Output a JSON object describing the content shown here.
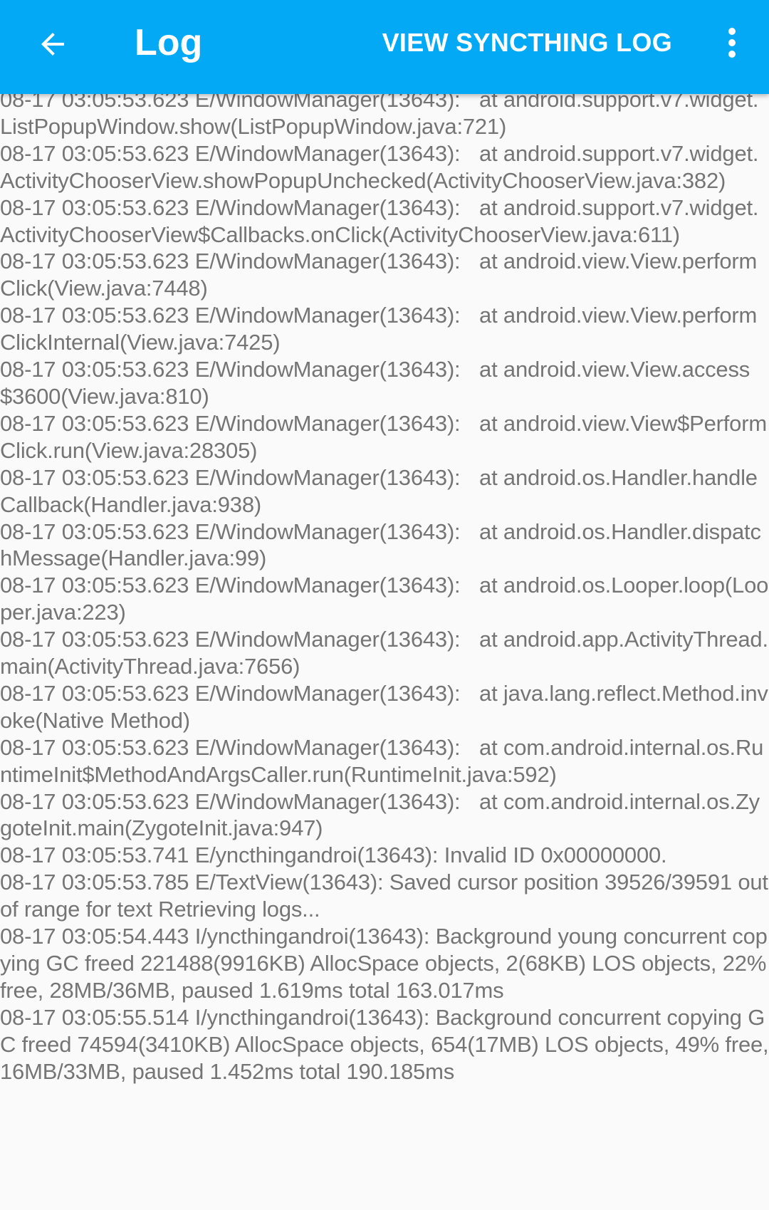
{
  "toolbar": {
    "title": "Log",
    "action_label": "VIEW SYNCTHING LOG",
    "back_icon": "arrow-back-icon",
    "overflow_icon": "more-vert-icon",
    "background_color": "#03a9f4"
  },
  "log": {
    "text": "08-17 03:05:53.623 E/WindowManager(13643): \tat android.support.v7.widget.ListPopupWindow.show(ListPopupWindow.java:721)\n08-17 03:05:53.623 E/WindowManager(13643): \tat android.support.v7.widget.ActivityChooserView.showPopupUnchecked(ActivityChooserView.java:382)\n08-17 03:05:53.623 E/WindowManager(13643): \tat android.support.v7.widget.ActivityChooserView$Callbacks.onClick(ActivityChooserView.java:611)\n08-17 03:05:53.623 E/WindowManager(13643): \tat android.view.View.performClick(View.java:7448)\n08-17 03:05:53.623 E/WindowManager(13643): \tat android.view.View.performClickInternal(View.java:7425)\n08-17 03:05:53.623 E/WindowManager(13643): \tat android.view.View.access$3600(View.java:810)\n08-17 03:05:53.623 E/WindowManager(13643): \tat android.view.View$PerformClick.run(View.java:28305)\n08-17 03:05:53.623 E/WindowManager(13643): \tat android.os.Handler.handleCallback(Handler.java:938)\n08-17 03:05:53.623 E/WindowManager(13643): \tat android.os.Handler.dispatchMessage(Handler.java:99)\n08-17 03:05:53.623 E/WindowManager(13643): \tat android.os.Looper.loop(Looper.java:223)\n08-17 03:05:53.623 E/WindowManager(13643): \tat android.app.ActivityThread.main(ActivityThread.java:7656)\n08-17 03:05:53.623 E/WindowManager(13643): \tat java.lang.reflect.Method.invoke(Native Method)\n08-17 03:05:53.623 E/WindowManager(13643): \tat com.android.internal.os.RuntimeInit$MethodAndArgsCaller.run(RuntimeInit.java:592)\n08-17 03:05:53.623 E/WindowManager(13643): \tat com.android.internal.os.ZygoteInit.main(ZygoteInit.java:947)\n08-17 03:05:53.741 E/yncthingandroi(13643): Invalid ID 0x00000000.\n08-17 03:05:53.785 E/TextView(13643): Saved cursor position 39526/39591 out of range for text Retrieving logs...\n08-17 03:05:54.443 I/yncthingandroi(13643): Background young concurrent copying GC freed 221488(9916KB) AllocSpace objects, 2(68KB) LOS objects, 22% free, 28MB/36MB, paused 1.619ms total 163.017ms\n08-17 03:05:55.514 I/yncthingandroi(13643): Background concurrent copying GC freed 74594(3410KB) AllocSpace objects, 654(17MB) LOS objects, 49% free, 16MB/33MB, paused 1.452ms total 190.185ms"
  }
}
